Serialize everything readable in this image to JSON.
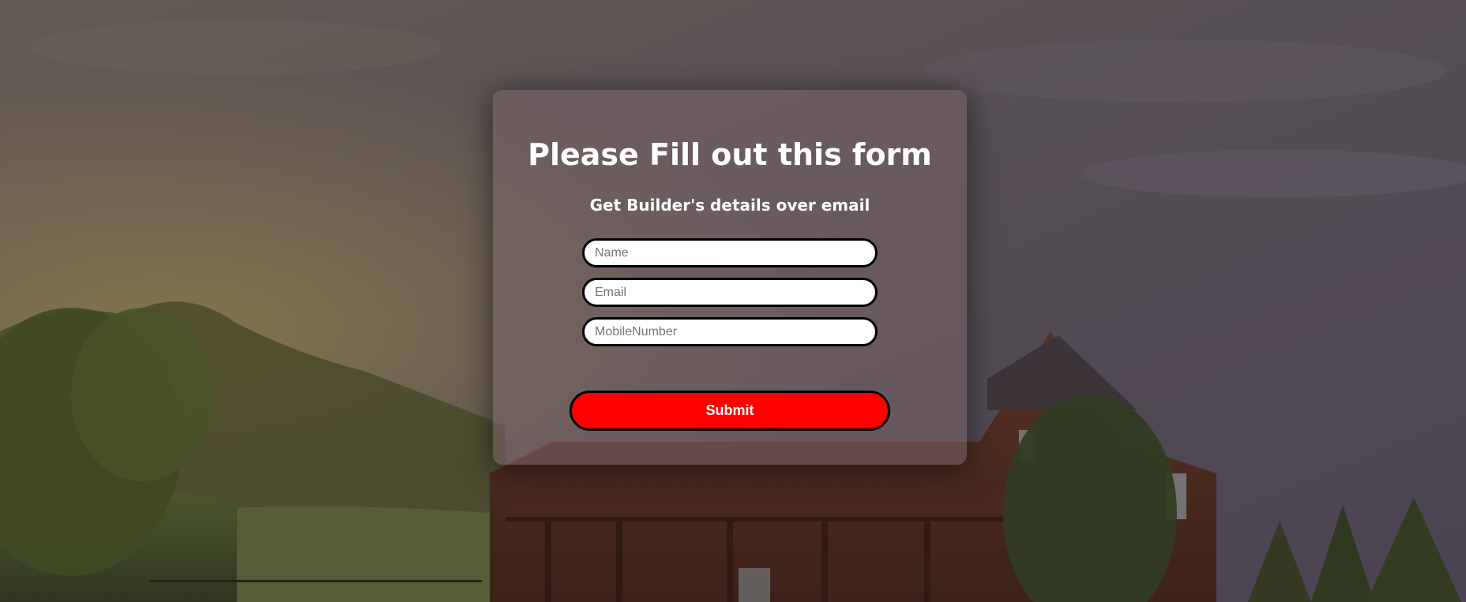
{
  "theme": {
    "card_overlay": "#786468",
    "submit_color": "#ff0000",
    "text_color": "#ffffff"
  },
  "background": {
    "image": "house-landscape-photo"
  },
  "form": {
    "title": "Please Fill out this form",
    "subtitle": "Get Builder's details over email",
    "fields": [
      {
        "name": "name",
        "placeholder": "Name",
        "value": ""
      },
      {
        "name": "email",
        "placeholder": "Email",
        "value": ""
      },
      {
        "name": "mobile",
        "placeholder": "MobileNumber",
        "value": ""
      }
    ],
    "submit_label": "Submit"
  }
}
